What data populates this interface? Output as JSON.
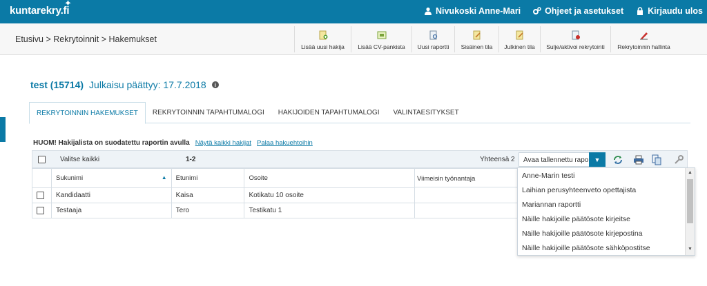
{
  "topbar": {
    "logo": "kuntarekry",
    "logo_suffix": ".fi",
    "user": "Nivukoski Anne-Mari",
    "help": "Ohjeet ja asetukset",
    "logout": "Kirjaudu ulos"
  },
  "breadcrumb": "Etusivu > Rekrytoinnit > Hakemukset",
  "tools": [
    {
      "label": "Lisää uusi hakija",
      "icon": "add-user-icon"
    },
    {
      "label": "Lisää CV-pankista",
      "icon": "cv-bank-icon"
    },
    {
      "label": "Uusi raportti",
      "icon": "report-icon"
    },
    {
      "label": "Sisäinen tila",
      "icon": "internal-status-icon"
    },
    {
      "label": "Julkinen tila",
      "icon": "public-status-icon"
    },
    {
      "label": "Sulje/aktivoi rekrytointi",
      "icon": "close-activate-icon"
    },
    {
      "label": "Rekrytoinnin hallinta",
      "icon": "manage-icon"
    }
  ],
  "title": {
    "id": "test (15714)",
    "published": "Julkaisu päättyy: 17.7.2018"
  },
  "tabs": [
    "REKRYTOINNIN HAKEMUKSET",
    "REKRYTOINNIN TAPAHTUMALOGI",
    "HAKIJOIDEN TAPAHTUMALOGI",
    "VALINTAESITYKSET"
  ],
  "notice": {
    "text": "HUOM! Hakijalista on suodatettu raportin avulla",
    "show_all": "Näytä kaikki hakijat",
    "back": "Palaa hakuehtoihin"
  },
  "grid": {
    "select_all": "Valitse kaikki",
    "range": "1-2",
    "total": "Yhteensä 2",
    "report_select": "Avaa tallennettu raportti",
    "columns": [
      "Sukunimi",
      "Etunimi",
      "Osoite",
      "Viimeisin työnantaja"
    ],
    "rows": [
      {
        "surname": "Kandidaatti",
        "firstname": "Kaisa",
        "address": "Kotikatu 10 osoite"
      },
      {
        "surname": "Testaaja",
        "firstname": "Tero",
        "address": "Testikatu 1"
      }
    ]
  },
  "report_options": [
    "Anne-Marin testi",
    "Laihian perusyhteenveto opettajista",
    "Mariannan raportti",
    "Näille hakijoille päätösote kirjeitse",
    "Näille hakijoille päätösote kirjepostina",
    "Näille hakijoille päätösote sähköpostitse"
  ],
  "colors": {
    "brand": "#0b7aa6",
    "toolbar_bg": "#f7f7f7"
  }
}
